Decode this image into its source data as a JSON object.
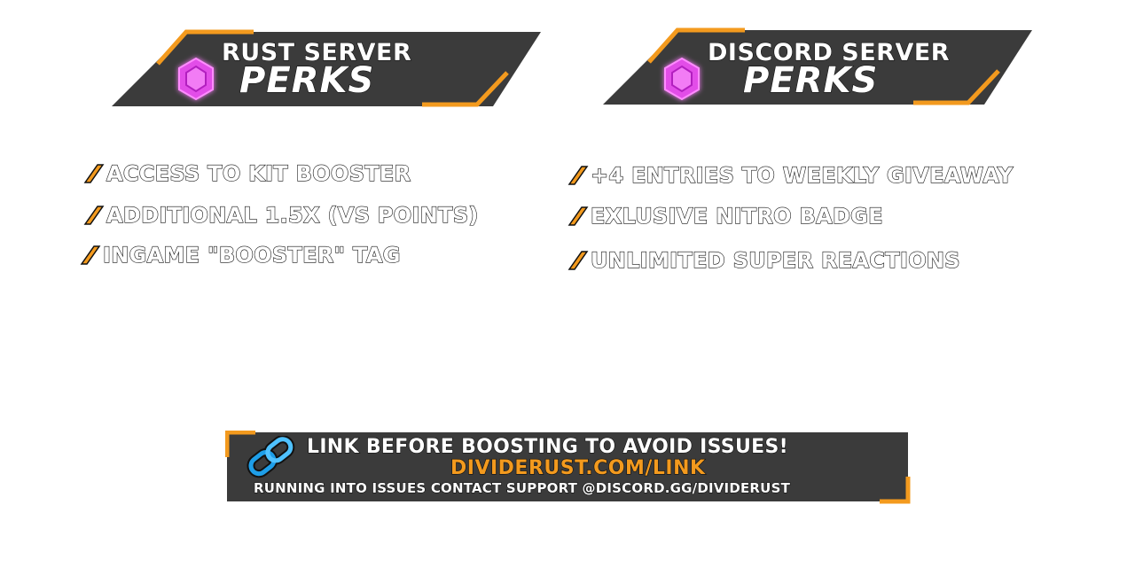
{
  "colors": {
    "accent": "#f39a1e",
    "banner": "#3b3b3b",
    "gem": "#e24de8",
    "link_icon": "#1e9ee8"
  },
  "rust": {
    "title_line1": "RUST SERVER",
    "title_line2": "PERKS",
    "icon": "gem-icon",
    "perks": [
      "ACCESS TO KIT BOOSTER",
      "ADDITIONAL 1.5X (VS POINTS)",
      "INGAME \"BOOSTER\" TAG"
    ]
  },
  "discord": {
    "title_line1": "DISCORD SERVER",
    "title_line2": "PERKS",
    "icon": "gem-icon",
    "perks": [
      "+4 ENTRIES TO WEEKLY GIVEAWAY",
      "EXLUSIVE NITRO BADGE",
      "UNLIMITED SUPER REACTIONS"
    ]
  },
  "footer": {
    "icon": "link-icon",
    "line1": "LINK BEFORE BOOSTING TO AVOID ISSUES!",
    "line2": "DIVIDERUST.COM/LINK",
    "line3": "RUNNING INTO ISSUES CONTACT SUPPORT @DISCORD.GG/DIVIDERUST"
  }
}
